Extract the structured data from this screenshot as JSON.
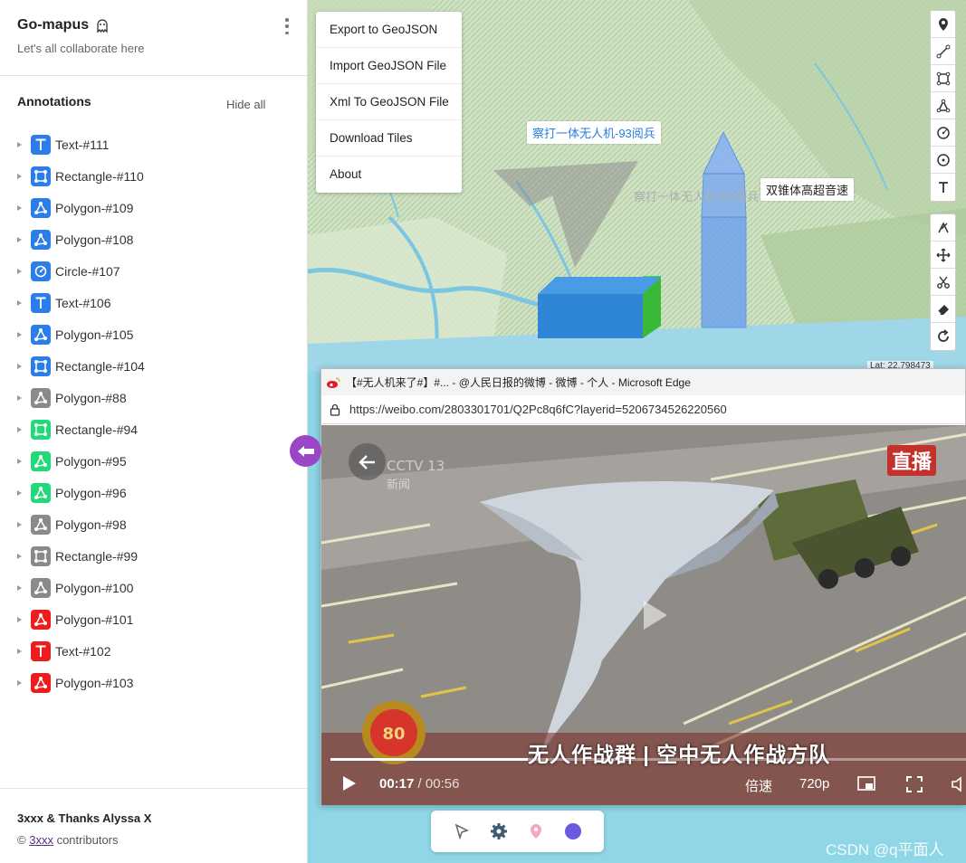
{
  "app": {
    "title": "Go-mapus",
    "subtitle": "Let's all collaborate here",
    "title_icon": "ghost-icon"
  },
  "annotations": {
    "heading": "Annotations",
    "hide_all": "Hide all",
    "items": [
      {
        "label": "Text-#111",
        "type": "text",
        "color": "#2b7de9"
      },
      {
        "label": "Rectangle-#110",
        "type": "rectangle",
        "color": "#2b7de9"
      },
      {
        "label": "Polygon-#109",
        "type": "polygon",
        "color": "#2b7de9"
      },
      {
        "label": "Polygon-#108",
        "type": "polygon",
        "color": "#2b7de9"
      },
      {
        "label": "Circle-#107",
        "type": "circle",
        "color": "#2b7de9"
      },
      {
        "label": "Text-#106",
        "type": "text",
        "color": "#2b7de9"
      },
      {
        "label": "Polygon-#105",
        "type": "polygon",
        "color": "#2b7de9"
      },
      {
        "label": "Rectangle-#104",
        "type": "rectangle",
        "color": "#2b7de9"
      },
      {
        "label": "Polygon-#88",
        "type": "polygon",
        "color": "#8a8a8a"
      },
      {
        "label": "Rectangle-#94",
        "type": "rectangle",
        "color": "#22d97a"
      },
      {
        "label": "Polygon-#95",
        "type": "polygon",
        "color": "#22d97a"
      },
      {
        "label": "Polygon-#96",
        "type": "polygon",
        "color": "#22d97a"
      },
      {
        "label": "Polygon-#98",
        "type": "polygon",
        "color": "#8a8a8a"
      },
      {
        "label": "Rectangle-#99",
        "type": "rectangle",
        "color": "#8a8a8a"
      },
      {
        "label": "Polygon-#100",
        "type": "polygon",
        "color": "#8a8a8a"
      },
      {
        "label": "Polygon-#101",
        "type": "polygon",
        "color": "#ee1c1c"
      },
      {
        "label": "Text-#102",
        "type": "text",
        "color": "#ee1c1c"
      },
      {
        "label": "Polygon-#103",
        "type": "polygon",
        "color": "#ee1c1c"
      }
    ]
  },
  "footer": {
    "credits": "3xxx & Thanks Alyssa X",
    "copyright_symbol": "©",
    "link": "3xxx",
    "contributors": "contributors"
  },
  "map_menu": {
    "items": [
      "Export to GeoJSON",
      "Import GeoJSON File",
      "Xml To GeoJSON File",
      "Download Tiles",
      "About"
    ]
  },
  "map": {
    "label_1": "察打一体无人机-93阅兵",
    "label_2": "双锥体高超音速",
    "label_faint": "察打一体无人机-93阅兵",
    "coordinates": "Lat: 22.798473",
    "draw_tools": [
      "marker-icon",
      "line-icon",
      "rectangle-icon",
      "polygon-icon",
      "circle-icon",
      "circle-marker-icon",
      "text-icon"
    ],
    "edit_tools": [
      "cut-polygon-icon",
      "move-icon",
      "scissors-icon",
      "eraser-icon",
      "rotate-icon"
    ]
  },
  "browser": {
    "title": "【#无人机来了#】#... - @人民日报的微博 - 微博 - 个人 - Microsoft Edge",
    "url": "https://weibo.com/2803301701/Q2Pc8q6fC?layerid=5206734526220560",
    "video": {
      "channel": "CCTV 13",
      "channel_sub": "新闻",
      "live_badge": "直播",
      "subtitle": "无人作战群 | 空中无人作战方队",
      "badge_text": "80",
      "current_time": "00:17",
      "duration": "00:56",
      "time_sep": "/",
      "progress": 0.31,
      "speed": "倍速",
      "quality": "720p"
    }
  },
  "bottom_toolbar": {
    "tools": [
      "cursor-icon",
      "settings-icon",
      "pin-icon",
      "color-dot-icon"
    ],
    "color": "#6a5ae0"
  },
  "watermark": "CSDN @q平面人"
}
